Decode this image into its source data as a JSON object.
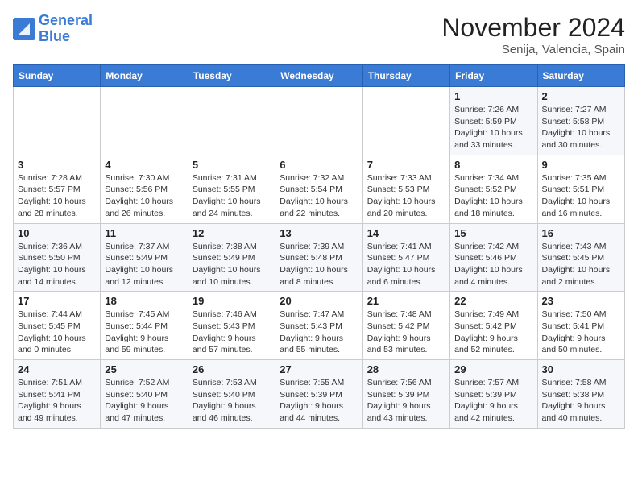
{
  "header": {
    "logo_line1": "General",
    "logo_line2": "Blue",
    "month": "November 2024",
    "location": "Senija, Valencia, Spain"
  },
  "weekdays": [
    "Sunday",
    "Monday",
    "Tuesday",
    "Wednesday",
    "Thursday",
    "Friday",
    "Saturday"
  ],
  "weeks": [
    [
      {
        "day": "",
        "info": ""
      },
      {
        "day": "",
        "info": ""
      },
      {
        "day": "",
        "info": ""
      },
      {
        "day": "",
        "info": ""
      },
      {
        "day": "",
        "info": ""
      },
      {
        "day": "1",
        "info": "Sunrise: 7:26 AM\nSunset: 5:59 PM\nDaylight: 10 hours and 33 minutes."
      },
      {
        "day": "2",
        "info": "Sunrise: 7:27 AM\nSunset: 5:58 PM\nDaylight: 10 hours and 30 minutes."
      }
    ],
    [
      {
        "day": "3",
        "info": "Sunrise: 7:28 AM\nSunset: 5:57 PM\nDaylight: 10 hours and 28 minutes."
      },
      {
        "day": "4",
        "info": "Sunrise: 7:30 AM\nSunset: 5:56 PM\nDaylight: 10 hours and 26 minutes."
      },
      {
        "day": "5",
        "info": "Sunrise: 7:31 AM\nSunset: 5:55 PM\nDaylight: 10 hours and 24 minutes."
      },
      {
        "day": "6",
        "info": "Sunrise: 7:32 AM\nSunset: 5:54 PM\nDaylight: 10 hours and 22 minutes."
      },
      {
        "day": "7",
        "info": "Sunrise: 7:33 AM\nSunset: 5:53 PM\nDaylight: 10 hours and 20 minutes."
      },
      {
        "day": "8",
        "info": "Sunrise: 7:34 AM\nSunset: 5:52 PM\nDaylight: 10 hours and 18 minutes."
      },
      {
        "day": "9",
        "info": "Sunrise: 7:35 AM\nSunset: 5:51 PM\nDaylight: 10 hours and 16 minutes."
      }
    ],
    [
      {
        "day": "10",
        "info": "Sunrise: 7:36 AM\nSunset: 5:50 PM\nDaylight: 10 hours and 14 minutes."
      },
      {
        "day": "11",
        "info": "Sunrise: 7:37 AM\nSunset: 5:49 PM\nDaylight: 10 hours and 12 minutes."
      },
      {
        "day": "12",
        "info": "Sunrise: 7:38 AM\nSunset: 5:49 PM\nDaylight: 10 hours and 10 minutes."
      },
      {
        "day": "13",
        "info": "Sunrise: 7:39 AM\nSunset: 5:48 PM\nDaylight: 10 hours and 8 minutes."
      },
      {
        "day": "14",
        "info": "Sunrise: 7:41 AM\nSunset: 5:47 PM\nDaylight: 10 hours and 6 minutes."
      },
      {
        "day": "15",
        "info": "Sunrise: 7:42 AM\nSunset: 5:46 PM\nDaylight: 10 hours and 4 minutes."
      },
      {
        "day": "16",
        "info": "Sunrise: 7:43 AM\nSunset: 5:45 PM\nDaylight: 10 hours and 2 minutes."
      }
    ],
    [
      {
        "day": "17",
        "info": "Sunrise: 7:44 AM\nSunset: 5:45 PM\nDaylight: 10 hours and 0 minutes."
      },
      {
        "day": "18",
        "info": "Sunrise: 7:45 AM\nSunset: 5:44 PM\nDaylight: 9 hours and 59 minutes."
      },
      {
        "day": "19",
        "info": "Sunrise: 7:46 AM\nSunset: 5:43 PM\nDaylight: 9 hours and 57 minutes."
      },
      {
        "day": "20",
        "info": "Sunrise: 7:47 AM\nSunset: 5:43 PM\nDaylight: 9 hours and 55 minutes."
      },
      {
        "day": "21",
        "info": "Sunrise: 7:48 AM\nSunset: 5:42 PM\nDaylight: 9 hours and 53 minutes."
      },
      {
        "day": "22",
        "info": "Sunrise: 7:49 AM\nSunset: 5:42 PM\nDaylight: 9 hours and 52 minutes."
      },
      {
        "day": "23",
        "info": "Sunrise: 7:50 AM\nSunset: 5:41 PM\nDaylight: 9 hours and 50 minutes."
      }
    ],
    [
      {
        "day": "24",
        "info": "Sunrise: 7:51 AM\nSunset: 5:41 PM\nDaylight: 9 hours and 49 minutes."
      },
      {
        "day": "25",
        "info": "Sunrise: 7:52 AM\nSunset: 5:40 PM\nDaylight: 9 hours and 47 minutes."
      },
      {
        "day": "26",
        "info": "Sunrise: 7:53 AM\nSunset: 5:40 PM\nDaylight: 9 hours and 46 minutes."
      },
      {
        "day": "27",
        "info": "Sunrise: 7:55 AM\nSunset: 5:39 PM\nDaylight: 9 hours and 44 minutes."
      },
      {
        "day": "28",
        "info": "Sunrise: 7:56 AM\nSunset: 5:39 PM\nDaylight: 9 hours and 43 minutes."
      },
      {
        "day": "29",
        "info": "Sunrise: 7:57 AM\nSunset: 5:39 PM\nDaylight: 9 hours and 42 minutes."
      },
      {
        "day": "30",
        "info": "Sunrise: 7:58 AM\nSunset: 5:38 PM\nDaylight: 9 hours and 40 minutes."
      }
    ]
  ]
}
